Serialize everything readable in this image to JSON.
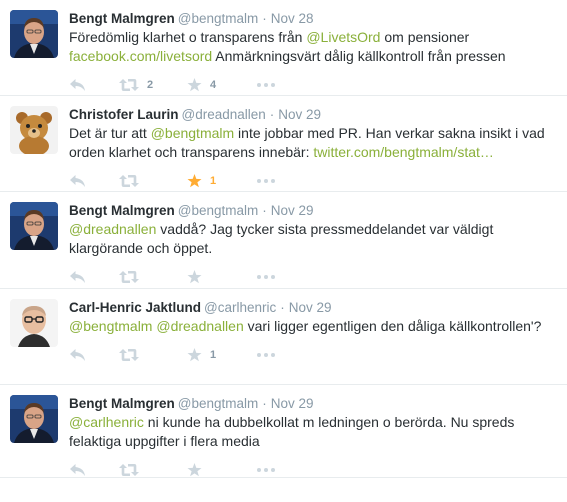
{
  "colors": {
    "link": "#8ab03a",
    "meta": "#8899a6",
    "icon_inactive": "#ccd6dd",
    "favorite_active": "#ffac33",
    "divider": "#e8ecee"
  },
  "icons": {
    "reply": "reply-icon",
    "retweet": "retweet-icon",
    "favorite": "star-icon",
    "more": "more-dots-icon"
  },
  "tweets": [
    {
      "fullname": "Bengt Malmgren",
      "username": "@bengtmalm",
      "separator": "·",
      "time": "Nov 28",
      "avatar": "bengt",
      "line1": [
        {
          "text": "Föredömlig klarhet o transparens från ",
          "link": false
        },
        {
          "text": "@LivetsOrd",
          "link": true
        },
        {
          "text": " om pensioner",
          "link": false
        }
      ],
      "line2": [
        {
          "text": "facebook.com/livetsord",
          "link": true
        },
        {
          "text": " Anmärkningsvärt dålig källkontroll från pressen",
          "link": false
        }
      ],
      "retweets": "2",
      "favorites": "4",
      "favorited": false
    },
    {
      "fullname": "Christofer Laurin",
      "username": "@dreadnallen",
      "separator": "·",
      "time": "Nov 29",
      "avatar": "bear",
      "line1": [
        {
          "text": "Det är tur att ",
          "link": false
        },
        {
          "text": "@bengtmalm",
          "link": true
        },
        {
          "text": " inte jobbar med PR. Han verkar sakna insikt i vad",
          "link": false
        }
      ],
      "line2": [
        {
          "text": "orden klarhet och  transparens innebär: ",
          "link": false
        },
        {
          "text": "twitter.com/bengtmalm/stat…",
          "link": true
        }
      ],
      "retweets": "",
      "favorites": "1",
      "favorited": true
    },
    {
      "fullname": "Bengt Malmgren",
      "username": "@bengtmalm",
      "separator": "·",
      "time": "Nov 29",
      "avatar": "bengt",
      "line1": [
        {
          "text": "@dreadnallen",
          "link": true
        },
        {
          "text": " vaddå? Jag tycker sista pressmeddelandet var väldigt",
          "link": false
        }
      ],
      "line2": [
        {
          "text": "klargörande och öppet.",
          "link": false
        }
      ],
      "retweets": "",
      "favorites": "",
      "favorited": false
    },
    {
      "fullname": "Carl-Henric Jaktlund",
      "username": "@carlhenric",
      "separator": "·",
      "time": "Nov 29",
      "avatar": "carl",
      "line1": [
        {
          "text": "@bengtmalm",
          "link": true
        },
        {
          "text": " ",
          "link": false
        },
        {
          "text": "@dreadnallen",
          "link": true
        },
        {
          "text": " vari ligger egentligen den dåliga källkontrollen'?",
          "link": false
        }
      ],
      "line2": [],
      "retweets": "",
      "favorites": "1",
      "favorited": false
    },
    {
      "fullname": "Bengt Malmgren",
      "username": "@bengtmalm",
      "separator": "·",
      "time": "Nov 29",
      "avatar": "bengt",
      "line1": [
        {
          "text": "@carlhenric",
          "link": true
        },
        {
          "text": " ni kunde ha dubbelkollat m ledningen o berörda. Nu spreds",
          "link": false
        }
      ],
      "line2": [
        {
          "text": "felaktiga uppgifter i flera media",
          "link": false
        }
      ],
      "retweets": "",
      "favorites": "",
      "favorited": false
    }
  ]
}
